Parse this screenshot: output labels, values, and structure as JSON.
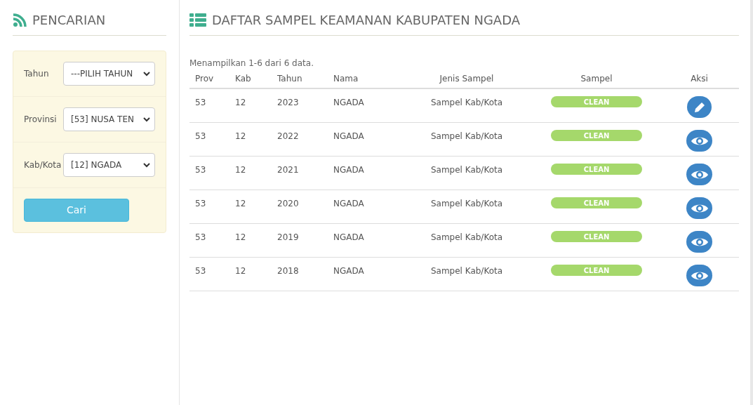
{
  "sidebar": {
    "title": "PENCARIAN",
    "fields": [
      {
        "label": "Tahun",
        "value": "---PILIH TAHUN"
      },
      {
        "label": "Provinsi",
        "value": "[53] NUSA TEN"
      },
      {
        "label": "Kab/Kota",
        "value": "[12] NGADA"
      }
    ],
    "button": "Cari"
  },
  "main": {
    "title": "DAFTAR SAMPEL KEAMANAN KABUPATEN NGADA",
    "summary": "Menampilkan 1-6 dari 6 data.",
    "table": {
      "columns": [
        "Prov",
        "Kab",
        "Tahun",
        "Nama",
        "Jenis Sampel",
        "Sampel",
        "Aksi"
      ],
      "rows": [
        {
          "prov": "53",
          "kab": "12",
          "tahun": "2023",
          "nama": "NGADA",
          "jenis": "Sampel Kab/Kota",
          "sampel": "CLEAN",
          "kind": "edit"
        },
        {
          "prov": "53",
          "kab": "12",
          "tahun": "2022",
          "nama": "NGADA",
          "jenis": "Sampel Kab/Kota",
          "sampel": "CLEAN",
          "kind": "view"
        },
        {
          "prov": "53",
          "kab": "12",
          "tahun": "2021",
          "nama": "NGADA",
          "jenis": "Sampel Kab/Kota",
          "sampel": "CLEAN",
          "kind": "view"
        },
        {
          "prov": "53",
          "kab": "12",
          "tahun": "2020",
          "nama": "NGADA",
          "jenis": "Sampel Kab/Kota",
          "sampel": "CLEAN",
          "kind": "view"
        },
        {
          "prov": "53",
          "kab": "12",
          "tahun": "2019",
          "nama": "NGADA",
          "jenis": "Sampel Kab/Kota",
          "sampel": "CLEAN",
          "kind": "view"
        },
        {
          "prov": "53",
          "kab": "12",
          "tahun": "2018",
          "nama": "NGADA",
          "jenis": "Sampel Kab/Kota",
          "sampel": "CLEAN",
          "kind": "view"
        }
      ]
    }
  }
}
